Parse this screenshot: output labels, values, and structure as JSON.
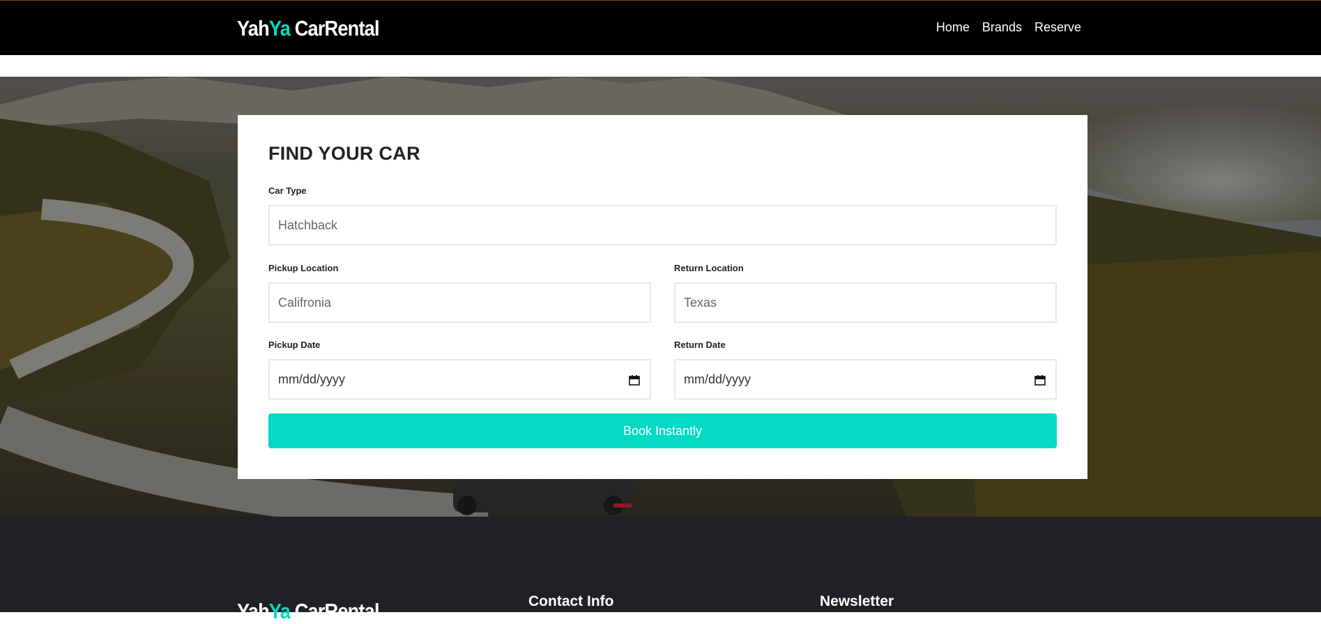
{
  "brand": {
    "part1": "Yah",
    "accent": "Ya",
    "part2": " CarRental"
  },
  "nav": {
    "items": [
      "Home",
      "Brands",
      "Reserve"
    ]
  },
  "form": {
    "title": "FIND YOUR CAR",
    "car_type": {
      "label": "Car Type",
      "placeholder": "Hatchback"
    },
    "pickup_location": {
      "label": "Pickup Location",
      "placeholder": "Califronia"
    },
    "return_location": {
      "label": "Return Location",
      "placeholder": "Texas"
    },
    "pickup_date": {
      "label": "Pickup Date",
      "placeholder": "mm/dd/yyyy"
    },
    "return_date": {
      "label": "Return Date",
      "placeholder": "mm/dd/yyyy"
    },
    "submit_label": "Book Instantly"
  },
  "footer": {
    "brand": {
      "part1": "Yah",
      "accent": "Ya",
      "part2": " CarRental"
    },
    "contact_title": "Contact Info",
    "newsletter_title": "Newsletter"
  },
  "colors": {
    "accent": "#04d9c4",
    "nav_bg": "#000000",
    "footer_bg": "#212025"
  }
}
